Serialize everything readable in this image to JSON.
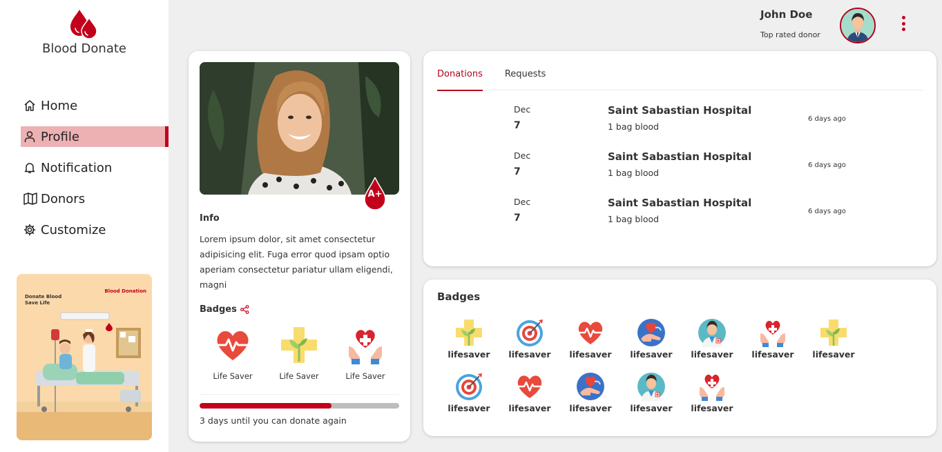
{
  "brand": {
    "name": "Blood Donate"
  },
  "sidebar": {
    "items": [
      {
        "label": "Home",
        "icon": "home-icon"
      },
      {
        "label": "Profile",
        "icon": "user-icon",
        "active": true
      },
      {
        "label": "Notification",
        "icon": "bell-icon"
      },
      {
        "label": "Donors",
        "icon": "map-icon"
      },
      {
        "label": "Customize",
        "icon": "gear-icon"
      }
    ],
    "promo": {
      "headline_line1": "Donate Blood",
      "headline_line2": "Save Life",
      "brand": "Blood Donation"
    }
  },
  "header": {
    "user_name": "John Doe",
    "user_subtitle": "Top rated donor"
  },
  "profile": {
    "blood_type": "A+",
    "info_title": "Info",
    "info_text": "Lorem ipsum dolor, sit amet consectetur adipisicing elit. Fuga error quod ipsam optio aperiam consectetur pariatur ullam eligendi, magni",
    "badges_title": "Badges",
    "badges": [
      {
        "label": "Life Saver",
        "icon": "heart-pulse-icon"
      },
      {
        "label": "Life Saver",
        "icon": "cross-plant-icon"
      },
      {
        "label": "Life Saver",
        "icon": "hands-heart-icon"
      }
    ],
    "progress_fraction": 0.66,
    "progress_text": "3 days until you can donate again"
  },
  "donations": {
    "tabs": [
      {
        "label": "Donations",
        "active": true
      },
      {
        "label": "Requests",
        "active": false
      }
    ],
    "rows": [
      {
        "month": "Dec",
        "day": "7",
        "hospital": "Saint Sabastian Hospital",
        "amount": "1 bag blood",
        "time": "6 days ago"
      },
      {
        "month": "Dec",
        "day": "7",
        "hospital": "Saint Sabastian Hospital",
        "amount": "1 bag blood",
        "time": "6 days ago"
      },
      {
        "month": "Dec",
        "day": "7",
        "hospital": "Saint Sabastian Hospital",
        "amount": "1 bag blood",
        "time": "6 days ago"
      }
    ]
  },
  "badges_panel": {
    "title": "Badges",
    "items": [
      {
        "label": "lifesaver",
        "icon": "cross-plant-icon"
      },
      {
        "label": "lifesaver",
        "icon": "target-icon"
      },
      {
        "label": "lifesaver",
        "icon": "heart-pulse-icon"
      },
      {
        "label": "lifesaver",
        "icon": "hand-heart-icon"
      },
      {
        "label": "lifesaver",
        "icon": "doctor-icon"
      },
      {
        "label": "lifesaver",
        "icon": "hands-heart-icon"
      },
      {
        "label": "lifesaver",
        "icon": "cross-plant-icon"
      },
      {
        "label": "lifesaver",
        "icon": "target-icon"
      },
      {
        "label": "lifesaver",
        "icon": "heart-pulse-icon"
      },
      {
        "label": "lifesaver",
        "icon": "hand-heart-icon"
      },
      {
        "label": "lifesaver",
        "icon": "doctor-icon"
      },
      {
        "label": "lifesaver",
        "icon": "hands-heart-icon"
      }
    ]
  },
  "colors": {
    "accent": "#c2001b",
    "active_nav_bg": "#edb1b4",
    "page_bg": "#efefef"
  }
}
